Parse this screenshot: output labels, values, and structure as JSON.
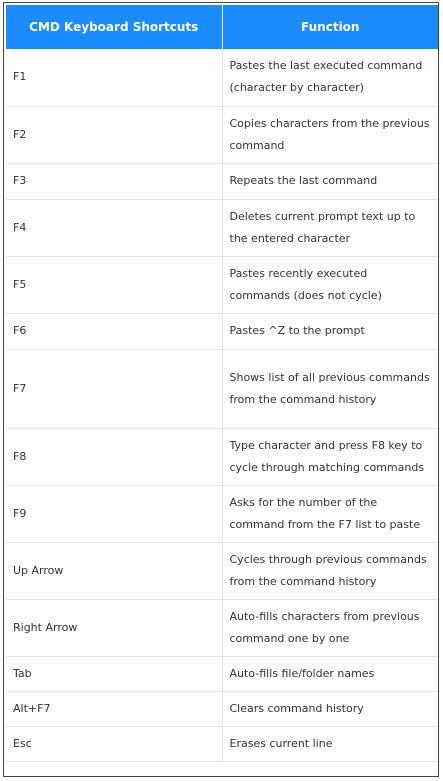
{
  "table": {
    "headers": [
      "CMD Keyboard Shortcuts",
      "Function"
    ],
    "rows": [
      {
        "key": "F1",
        "function": "Pastes the last executed command (character by character)"
      },
      {
        "key": "F2",
        "function": "Copies characters from the previous command"
      },
      {
        "key": "F3",
        "function": "Repeats the last command"
      },
      {
        "key": "F4",
        "function": "Deletes current prompt text up to the entered character"
      },
      {
        "key": "F5",
        "function": "Pastes recently executed commands (does not cycle)"
      },
      {
        "key": "F6",
        "function": "Pastes ^Z to the prompt"
      },
      {
        "key": "F7",
        "function": "Shows list of all previous commands from the command history"
      },
      {
        "key": "F8",
        "function": "Type character and press F8 key to cycle through matching commands"
      },
      {
        "key": "F9",
        "function": "Asks for the number of the command from the F7 list to paste"
      },
      {
        "key": "Up Arrow",
        "function": "Cycles through previous commands from the command history"
      },
      {
        "key": "Right Arrow",
        "function": "Auto-fills characters from previous command one by one"
      },
      {
        "key": "Tab",
        "function": "Auto-fills file/folder names"
      },
      {
        "key": "Alt+F7",
        "function": "Clears command history"
      },
      {
        "key": "Esc",
        "function": "Erases current line"
      }
    ]
  },
  "colors": {
    "header_bg": "#1a8cff",
    "header_text": "#ffffff",
    "body_text": "#333333",
    "grid": "#e3e3e3"
  }
}
